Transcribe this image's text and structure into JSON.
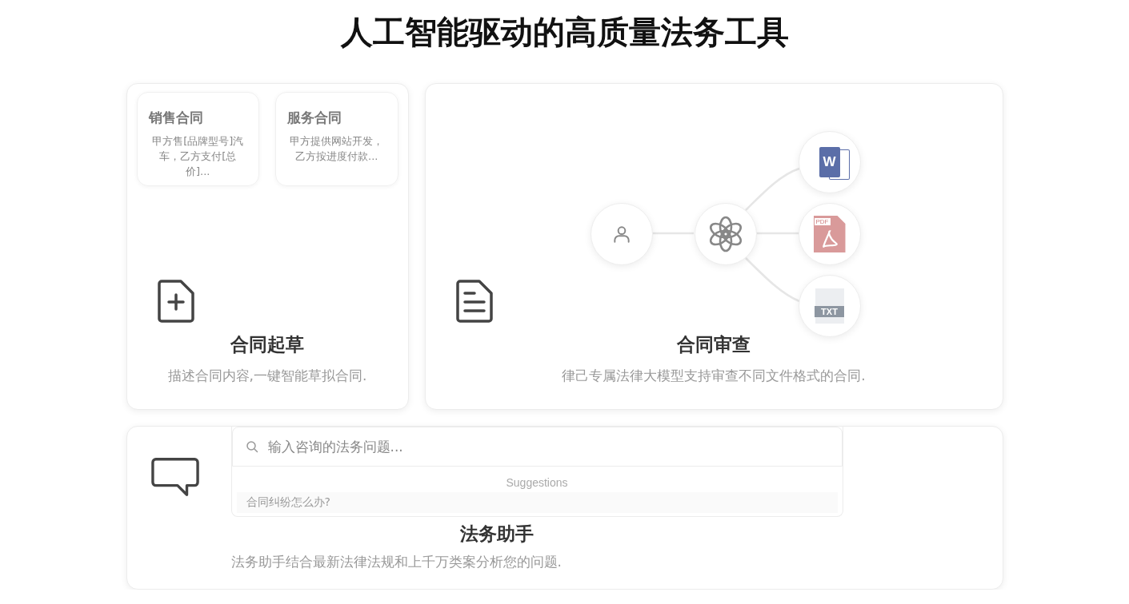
{
  "title": "人工智能驱动的高质量法务工具",
  "cards": [
    {
      "kind": "draft",
      "title": "合同起草",
      "description": "描述合同内容,一键智能草拟合同.",
      "templates": [
        {
          "title": "销售合同",
          "text": "甲方售[品牌型号]汽车，乙方支付[总价]..."
        },
        {
          "title": "服务合同",
          "text": "甲方提供网站开发，乙方按进度付款..."
        }
      ]
    },
    {
      "kind": "review",
      "title": "合同审查",
      "description": "律己专属法律大模型支持审查不同文件格式的合同.",
      "files": [
        {
          "kind": "word",
          "label": "W"
        },
        {
          "kind": "pdf",
          "label": "PDF"
        },
        {
          "kind": "txt",
          "label": "TXT"
        }
      ]
    },
    {
      "kind": "assistant",
      "title": "法务助手",
      "description": "法务助手结合最新法律法规和上千万类案分析您的问题.",
      "search": {
        "placeholder": "输入咨询的法务问题..."
      },
      "suggestions_heading": "Suggestions",
      "suggestions": [
        "合同纠纷怎么办?"
      ]
    }
  ]
}
